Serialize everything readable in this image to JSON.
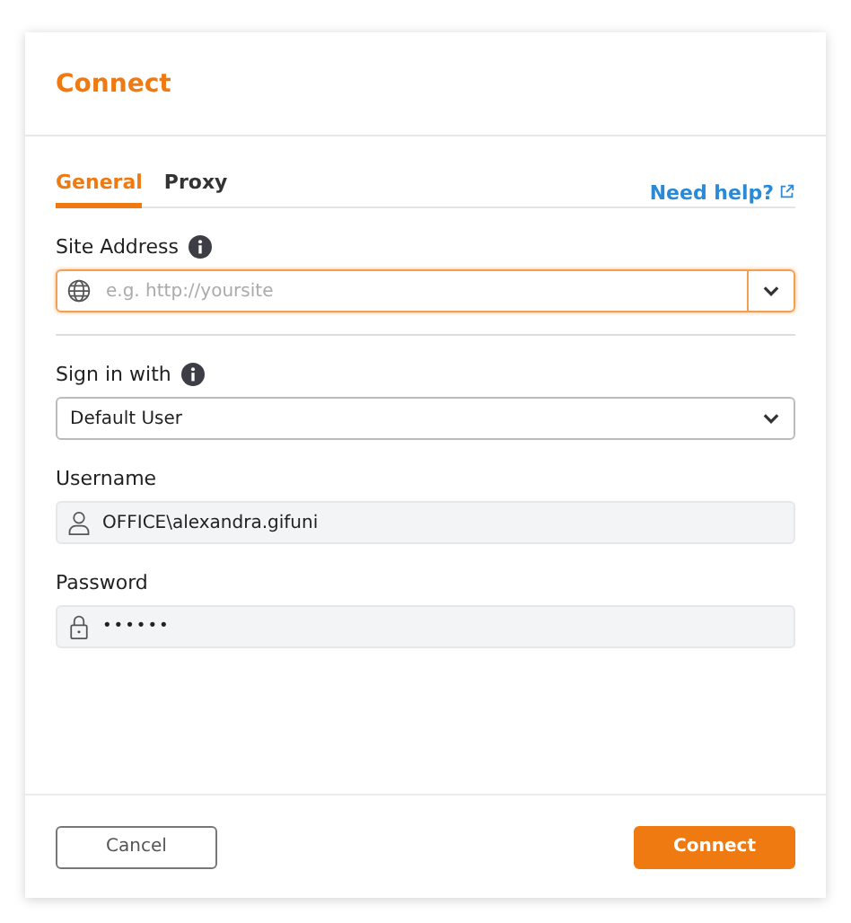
{
  "dialog": {
    "title": "Connect"
  },
  "tabs": [
    {
      "label": "General",
      "selected": true
    },
    {
      "label": "Proxy",
      "selected": false
    }
  ],
  "help_link": "Need help?",
  "site_address": {
    "label": "Site Address",
    "placeholder": "e.g. http://yoursite",
    "focused": true
  },
  "sign_in_with": {
    "label": "Sign in with",
    "value": "Default User"
  },
  "username": {
    "label": "Username",
    "value": "OFFICE\\alexandra.gifuni"
  },
  "password": {
    "label": "Password",
    "value": "••••••"
  },
  "buttons": [
    {
      "label": "Cancel",
      "kind": "secondary"
    },
    {
      "label": "Connect",
      "kind": "primary"
    }
  ]
}
